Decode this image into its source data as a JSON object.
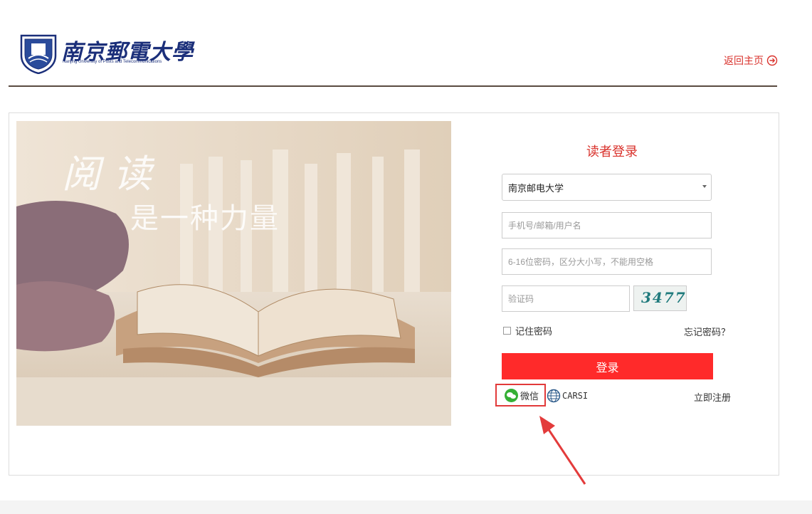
{
  "header": {
    "logo_cn": "南京郵電大學",
    "logo_en": "Nanjing University of Posts and Telecommunications",
    "back_home": "返回主页"
  },
  "hero": {
    "title_line1": "阅读",
    "title_line2": "是一种力量"
  },
  "login": {
    "title": "读者登录",
    "institution_selected": "南京邮电大学",
    "username_placeholder": "手机号/邮箱/用户名",
    "password_placeholder": "6-16位密码，区分大小写，不能用空格",
    "captcha_placeholder": "验证码",
    "captcha_text": "3477",
    "remember_label": "记住密码",
    "forgot_label": "忘记密码？",
    "submit_label": "登录",
    "wechat_label": "微信",
    "carsi_label": "CARSI",
    "register_label": "立即注册"
  },
  "colors": {
    "accent_red": "#d9312b",
    "button_red": "#ff2a2a",
    "wechat_green": "#35b035",
    "logo_blue": "#1b2f7a"
  }
}
